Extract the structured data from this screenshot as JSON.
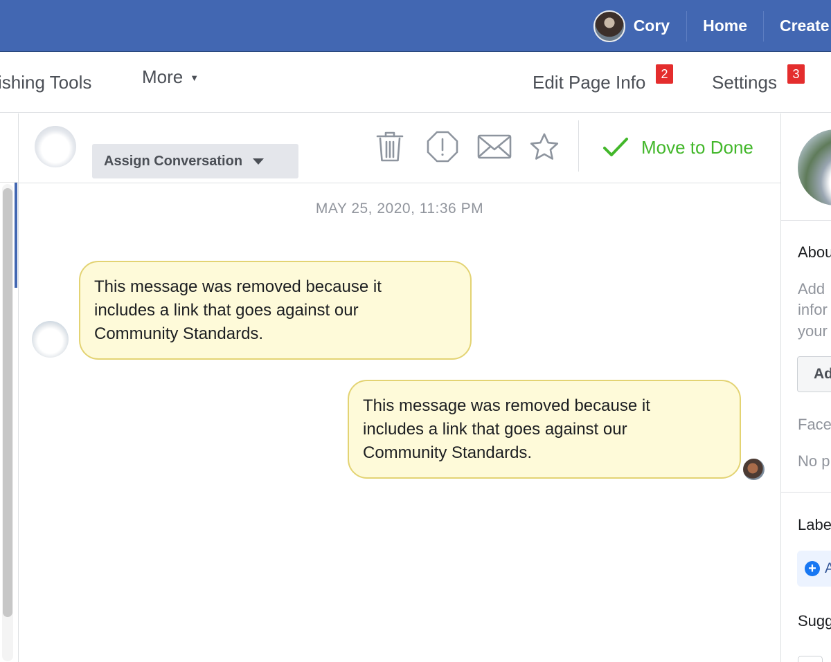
{
  "topbar": {
    "profile_name": "Cory",
    "links": [
      "Home",
      "Create"
    ]
  },
  "subnav": {
    "publishing_tools": "ishing Tools",
    "more": "More",
    "edit_page_info": "Edit Page Info",
    "edit_page_info_badge": "2",
    "settings": "Settings",
    "settings_badge": "3"
  },
  "conversation": {
    "assign_label": "Assign Conversation",
    "move_to_done": "Move to Done",
    "icons": [
      "trash-icon",
      "spam-alert-icon",
      "mail-icon",
      "star-icon",
      "checkmark-icon"
    ]
  },
  "thread": {
    "timestamp": "MAY 25, 2020, 11:36 PM",
    "messages": [
      {
        "side": "left",
        "lines": [
          "This message was removed because it",
          "includes a link that goes against our",
          "Community Standards."
        ]
      },
      {
        "side": "right",
        "lines": [
          "This message was removed because it",
          "includes a link that goes against our",
          "Community Standards."
        ]
      }
    ]
  },
  "right_panel": {
    "about_heading": "Abou",
    "about_lines": [
      "Add",
      "infor",
      "your"
    ],
    "add_button": "Ad",
    "facebook_label": "Face",
    "no_label": "No p",
    "labels_heading": "Labe",
    "add_label": "A",
    "suggested_heading": "Sugg"
  },
  "colors": {
    "brand_blue": "#4267b2",
    "done_green": "#42b72a",
    "badge_red": "#e42d2d",
    "bubble_fill": "#fefad9",
    "bubble_border": "#e3d373"
  }
}
